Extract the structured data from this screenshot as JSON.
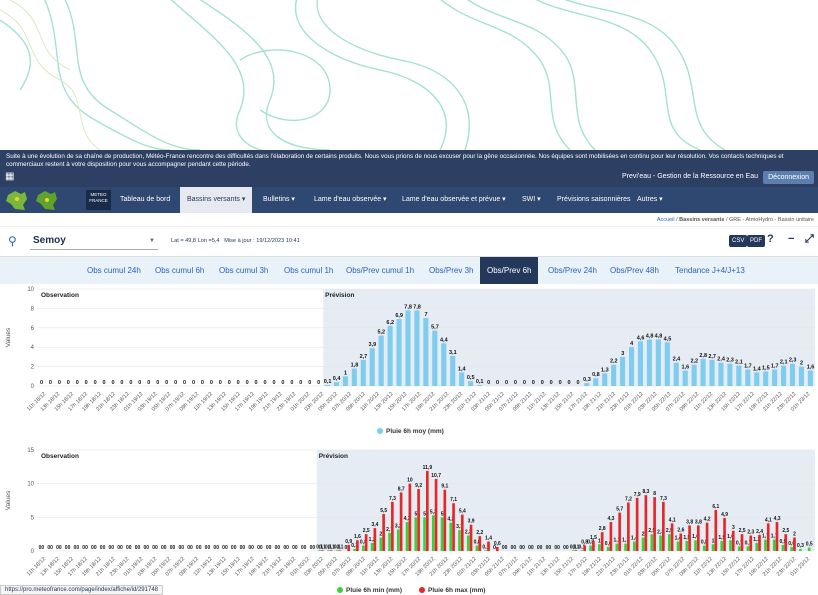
{
  "banner": {
    "text": "Suite à une évolution de sa chaîne de production, Météo-France rencontre des difficultés dans l'élaboration de certains produits. Nous vous prions de nous excuser pour la gêne occasionnée. Nos équipes sont mobilisées en continu pour leur résolution. Vos contacts techniques et commerciaux restent à votre disposition pour vous accompagner pendant cette période."
  },
  "topbar": {
    "site_title": "Previ'eau - Gestion de la Ressource en Eau",
    "logout": "Déconnexion",
    "calendar_icon": "calendar-icon"
  },
  "brand": {
    "line1": "METEO",
    "line2": "FRANCE"
  },
  "nav": [
    {
      "label": "Tableau de bord",
      "active": false
    },
    {
      "label": "Bassins versants ▾",
      "active": true
    },
    {
      "label": "Bulletins ▾",
      "active": false
    },
    {
      "label": "Lame d'eau observée ▾",
      "active": false
    },
    {
      "label": "Lame d'eau observée et prévue ▾",
      "active": false
    },
    {
      "label": "SWI ▾",
      "active": false
    },
    {
      "label": "Prévisions saisonnières",
      "active": false
    },
    {
      "label": "Autres ▾",
      "active": false
    }
  ],
  "breadcrumb": [
    "Accueil",
    "Bassins versants",
    "GRE - AtmoHydro - Bassin unitaire"
  ],
  "station": {
    "name": "Semoy",
    "coords": "Lat = 49,8 Lon =5,4",
    "updated": "Mise à jour : 19/12/2023 10:41",
    "csv": "CSV",
    "pdf": "PDF",
    "help": "?",
    "minimize": "−",
    "expand": "⤢"
  },
  "tabs": [
    {
      "label": "Obs cumul 24h",
      "active": false
    },
    {
      "label": "Obs cumul 6h",
      "active": false
    },
    {
      "label": "Obs cumul 3h",
      "active": false
    },
    {
      "label": "Obs cumul 1h",
      "active": false
    },
    {
      "label": "Obs/Prev cumul 1h",
      "active": false
    },
    {
      "label": "Obs/Prev 3h",
      "active": false
    },
    {
      "label": "Obs/Prev 6h",
      "active": true
    },
    {
      "label": "Obs/Prev 24h",
      "active": false
    },
    {
      "label": "Obs/Prev 48h",
      "active": false
    },
    {
      "label": "Tendance J+4/J+13",
      "active": false
    }
  ],
  "status_url": "https://pro.meteofrance.com/page/index/affiche/id/291748",
  "chart_data": [
    {
      "type": "bar",
      "ylabel": "Values",
      "ylim": [
        0,
        10
      ],
      "yticks": [
        0,
        2,
        4,
        6,
        8,
        10
      ],
      "region_labels": {
        "obs": "Observation",
        "prev": "Prévision"
      },
      "categories": [
        "11h 18/12",
        "13h 18/12",
        "15h 18/12",
        "17h 18/12",
        "19h 18/12",
        "21h 18/12",
        "23h 18/12",
        "01h 19/12",
        "03h 19/12",
        "05h 19/12",
        "07h 19/12",
        "09h 19/12",
        "11h 19/12",
        "13h 19/12",
        "15h 19/12",
        "17h 19/12",
        "19h 19/12",
        "21h 19/12",
        "23h 19/12",
        "01h 20/12",
        "03h 20/12",
        "05h 20/12",
        "07h 20/12",
        "09h 20/12",
        "11h 20/12",
        "13h 20/12",
        "15h 20/12",
        "17h 20/12",
        "19h 20/12",
        "21h 20/12",
        "23h 20/12",
        "01h 21/12",
        "03h 21/12",
        "05h 21/12",
        "07h 21/12",
        "09h 21/12",
        "11h 21/12",
        "13h 21/12",
        "15h 21/12",
        "17h 21/12",
        "19h 21/12",
        "21h 21/12",
        "23h 21/12",
        "01h 22/12",
        "03h 22/12",
        "05h 22/12",
        "07h 22/12",
        "09h 22/12",
        "11h 22/12",
        "13h 22/12",
        "15h 22/12",
        "17h 22/12",
        "19h 22/12",
        "21h 22/12",
        "23h 22/12",
        "01h 23/12"
      ],
      "series": [
        {
          "name": "Pluie 6h moy (mm)",
          "color": "#7ecdf0",
          "values": [
            0,
            0,
            0,
            0,
            0,
            0,
            0,
            0,
            0,
            0,
            0,
            0,
            0,
            0,
            0,
            0,
            0,
            0,
            0,
            0,
            0,
            0,
            0,
            0,
            0,
            0,
            0,
            0,
            0,
            0,
            0,
            0,
            0.1,
            0.4,
            1,
            1.8,
            2.7,
            3.9,
            5.2,
            6.2,
            6.9,
            7.8,
            7.8,
            7,
            5.7,
            4.4,
            3.1,
            1.4,
            0.5,
            0.1,
            0,
            0,
            0,
            0,
            0,
            0,
            0,
            0,
            0,
            0,
            0,
            0.3,
            0.8,
            1.3,
            2.2,
            3,
            4,
            4.6,
            4.8,
            4.8,
            4.5,
            2.4,
            1.6,
            2.2,
            2.8,
            2.7,
            2.4,
            2.3,
            2.1,
            1.7,
            1.4,
            1.5,
            1.7,
            2.1,
            2.3,
            2,
            1.6
          ]
        }
      ]
    },
    {
      "type": "bar",
      "ylabel": "Values",
      "ylim": [
        0,
        15
      ],
      "yticks": [
        0,
        5,
        10,
        15
      ],
      "region_labels": {
        "obs": "Observation",
        "prev": "Prévision"
      },
      "series": [
        {
          "name": "Pluie 6h min (mm)",
          "color": "#3bd13b",
          "values": [
            0,
            0,
            0,
            0,
            0,
            0,
            0,
            0,
            0,
            0,
            0,
            0,
            0,
            0,
            0,
            0,
            0,
            0,
            0,
            0,
            0,
            0,
            0,
            0,
            0,
            0,
            0,
            0,
            0,
            0,
            0,
            0,
            0.1,
            0.1,
            0.1,
            0,
            0.3,
            0.8,
            1.2,
            2,
            2.7,
            3.2,
            4.3,
            5,
            5,
            5.3,
            5,
            4.2,
            3.1,
            2.3,
            0.8,
            0.1,
            0,
            0,
            0,
            0,
            0,
            0,
            0,
            0,
            0,
            0.1,
            0.1,
            0.8,
            1.0,
            0.6,
            1.1,
            1.1,
            1.4,
            2.0,
            2.5,
            2.3,
            2.5,
            1.4,
            1.5,
            1.6,
            0.8,
            1,
            1.5,
            1.6,
            0.7,
            0.7,
            1.2,
            1.7,
            1.7,
            0.9,
            0.6,
            0.3,
            0.5
          ]
        },
        {
          "name": "Pluie 6h max (mm)",
          "color": "#e82626",
          "values": [
            0,
            0,
            0,
            0,
            0,
            0,
            0,
            0,
            0,
            0,
            0,
            0,
            0,
            0,
            0,
            0,
            0,
            0,
            0,
            0,
            0,
            0,
            0,
            0,
            0,
            0,
            0,
            0,
            0,
            0,
            0,
            0,
            0.1,
            0.1,
            0.1,
            0.9,
            1.6,
            2.5,
            3.4,
            5.5,
            7.3,
            8.7,
            10,
            9.2,
            11.9,
            10.7,
            9.1,
            7.1,
            5.4,
            3.9,
            2.2,
            1.4,
            0.6,
            0,
            0,
            0,
            0,
            0,
            0,
            0,
            0,
            0.1,
            0.8,
            1.5,
            2.8,
            4.3,
            5.7,
            7.2,
            7.9,
            8.3,
            8,
            7.3,
            4.1,
            2.6,
            3.8,
            3.8,
            4.2,
            6.1,
            4.9,
            3,
            2.5,
            2.3,
            2.4,
            4.1,
            4.3,
            2.5,
            2
          ]
        }
      ]
    }
  ]
}
